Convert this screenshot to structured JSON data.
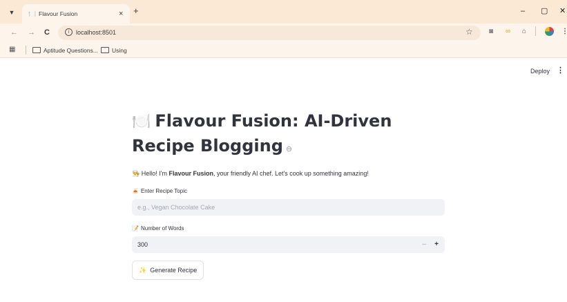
{
  "browser": {
    "tab": {
      "favicon": "🍽️",
      "title": "Flavour Fusion",
      "close": "×"
    },
    "new_tab": "+",
    "window_controls": {
      "minimize": "–",
      "maximize": "▢",
      "close": "✕"
    },
    "nav": {
      "back": "←",
      "forward": "→",
      "reload": "C"
    },
    "url": "localhost:8501",
    "bookmarks": [
      {
        "label": "Aptitude Questions..."
      },
      {
        "label": "Using"
      }
    ]
  },
  "app": {
    "deploy_label": "Deploy",
    "menu_glyph": "⋮",
    "title_emoji": "🍽️",
    "title": "Flavour Fusion: AI-Driven Recipe Blogging",
    "anchor_glyph": "⊖",
    "intro": {
      "emoji": "👨‍🍳",
      "before": "Hello! I'm ",
      "name": "Flavour Fusion",
      "after": ", your friendly AI chef. Let's cook up something amazing!"
    },
    "topic": {
      "emoji": "🍝",
      "label": "Enter Recipe Topic",
      "placeholder": "e.g., Vegan Chocolate Cake",
      "value": ""
    },
    "words": {
      "emoji": "📝",
      "label": "Number of Words",
      "value": "300",
      "minus": "–",
      "plus": "+"
    },
    "generate": {
      "emoji": "✨",
      "label": "Generate Recipe"
    }
  }
}
